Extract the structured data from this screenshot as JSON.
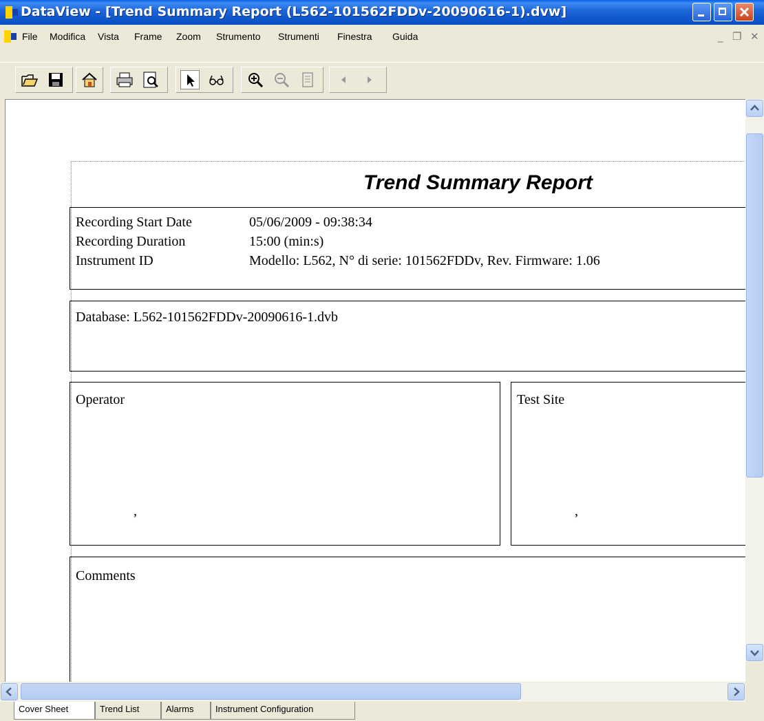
{
  "window": {
    "title": "DataView - [Trend Summary Report (L562-101562FDDv-20090616-1).dvw]"
  },
  "menu": {
    "items": [
      "File",
      "Modifica",
      "Vista",
      "Frame",
      "Zoom",
      "Strumento",
      "Strumenti",
      "Finestra",
      "Guida"
    ],
    "mdi_minimize": "_",
    "mdi_restore": "❐",
    "mdi_close": "✕"
  },
  "toolbar": {
    "buttons": [
      "open-icon",
      "save-icon",
      "home-icon",
      "print-icon",
      "print-preview-icon",
      "pointer-icon",
      "glasses-icon",
      "zoom-in-icon",
      "zoom-out-icon",
      "fit-page-icon",
      "previous-icon",
      "next-icon"
    ]
  },
  "report": {
    "title": "Trend Summary Report",
    "info": {
      "start_label": "Recording Start Date",
      "start_value": "05/06/2009 - 09:38:34",
      "duration_label": "Recording Duration",
      "duration_value": "15:00 (min:s)",
      "instrument_label": "Instrument ID",
      "instrument_value": "Modello: L562, N° di serie: 101562FDDv, Rev. Firmware: 1.06"
    },
    "database": "Database: L562-101562FDDv-20090616-1.dvb",
    "operator": {
      "label": "Operator",
      "value": ","
    },
    "test_site": {
      "label": "Test Site",
      "value": ","
    },
    "comments": {
      "label": "Comments"
    }
  },
  "tabs": [
    {
      "label": "Cover Sheet",
      "active": true
    },
    {
      "label": "Trend List",
      "active": false
    },
    {
      "label": "Alarms",
      "active": false
    },
    {
      "label": "Instrument Configuration",
      "active": false
    }
  ],
  "colors": {
    "titlebar": "#1b63d8",
    "chrome": "#ece9d8",
    "scroll_thumb": "#c6d7f7"
  }
}
